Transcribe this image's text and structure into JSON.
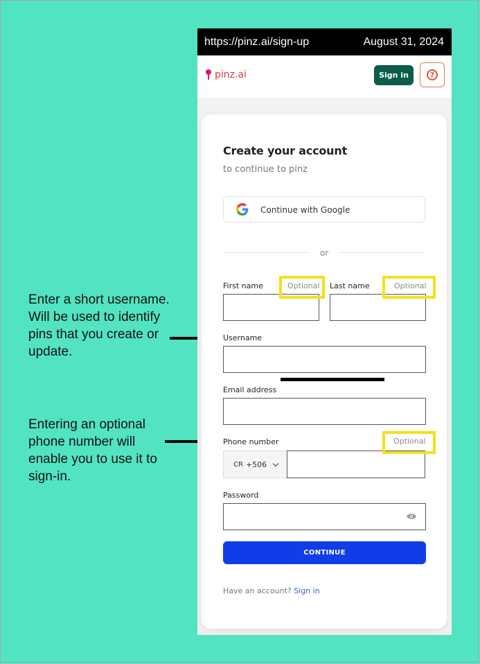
{
  "annotations": {
    "note1": "Enter a short username. Will be used to identify pins that you create or update.",
    "note2": "Entering an optional phone number will enable you to use it to sign-in."
  },
  "browser": {
    "url": "https://pinz.ai/sign-up",
    "date": "August 31, 2024"
  },
  "nav": {
    "brand": "pinz.ai",
    "signin_label": "Sign in",
    "help_label": "?"
  },
  "form": {
    "title": "Create your account",
    "subtitle": "to continue to pinz",
    "google_label": "Continue with Google",
    "or_label": "or",
    "first_name_label": "First name",
    "last_name_label": "Last name",
    "optional_label": "Optional",
    "username_label": "Username",
    "email_label": "Email address",
    "phone_label": "Phone number",
    "country_code": "CR",
    "dial_code": "+506",
    "password_label": "Password",
    "continue_label": "CONTINUE",
    "have_account": "Have an account?",
    "signin_link": "Sign in"
  },
  "colors": {
    "background": "#52e3c2",
    "brand": "#d33b3b",
    "primary": "#103de8",
    "signin_bg": "#0c5c4a",
    "highlight": "#f5e01b"
  }
}
